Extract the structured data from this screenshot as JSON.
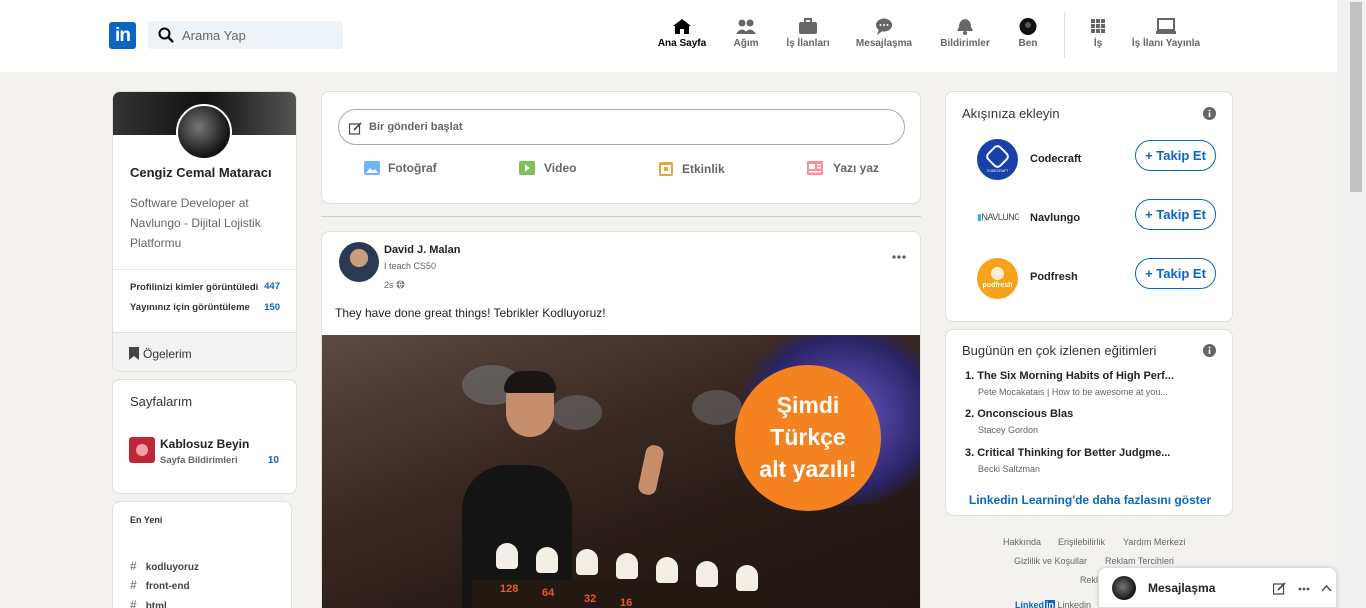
{
  "search": {
    "placeholder": "Arama Yap"
  },
  "nav": {
    "home": "Ana Sayfa",
    "network": "Ağım",
    "jobs": "İş İlanları",
    "messaging": "Mesajlaşma",
    "notifications": "Bildirimler",
    "me": "Ben",
    "work": "İş",
    "post_job": "İş İlanı Yayınla"
  },
  "profile": {
    "name": "Cengiz Cemal Mataracı",
    "headline": "Software Developer at Navlungo - Dijital Lojistik Platformu",
    "stat1_label": "Profilinizi kimler görüntüledi",
    "stat1_value": "447",
    "stat2_label": "Yayınınız için görüntüleme",
    "stat2_value": "150",
    "items": "Ögelerim"
  },
  "pages": {
    "title": "Sayfalarım",
    "name": "Kablosuz Beyin",
    "sub": "Sayfa Bildirimleri",
    "count": "10"
  },
  "recent": {
    "title": "En Yeni",
    "tags": [
      "kodluyoruz",
      "front-end",
      "html"
    ]
  },
  "composer": {
    "placeholder": "Bir gönderi başlat",
    "photo": "Fotoğraf",
    "video": "Video",
    "event": "Etkinlik",
    "article": "Yazı yaz"
  },
  "post": {
    "author": "David J. Malan",
    "subtitle": "I teach CS50",
    "time": "2s",
    "text": "They have done great things! Tebrikler Kodluyoruz!",
    "badge_line1": "Şimdi",
    "badge_line2": "Türkçe",
    "badge_line3": "alt yazılı!",
    "bulbs": [
      "128",
      "64",
      "32",
      "16"
    ]
  },
  "feed": {
    "title": "Akışınıza ekleyin",
    "follow_label": "+ Takip Et",
    "items": [
      {
        "name": "Codecraft",
        "logo_text": "CODECRAFT"
      },
      {
        "name": "Navlungo",
        "logo_text": "NAVLUNGO"
      },
      {
        "name": "Podfresh",
        "logo_text": "podfresh"
      }
    ]
  },
  "learning": {
    "title": "Bugünün en çok izlenen eğitimleri",
    "courses": [
      {
        "title": "1. The Six Morning Habits of High Perf...",
        "author": "Pete Mocakatais | How to be awesome at you..."
      },
      {
        "title": "2. Onconscious Blas",
        "author": "Stacey Gordon"
      },
      {
        "title": "3. Critical Thinking for Better Judgme...",
        "author": "Becki Saltzman"
      }
    ],
    "more": "Linkedin Learning'de daha fazlasını göster"
  },
  "footer": {
    "links": [
      "Hakkında",
      "Erişilebilirlik",
      "Yardım Merkezi",
      "Gizlilik ve Koşullar",
      "Reklam Tercihleri",
      "Rekl"
    ],
    "brand": "Linked",
    "brand_rest": "Linkedin"
  },
  "messaging": {
    "title": "Mesajlaşma"
  }
}
